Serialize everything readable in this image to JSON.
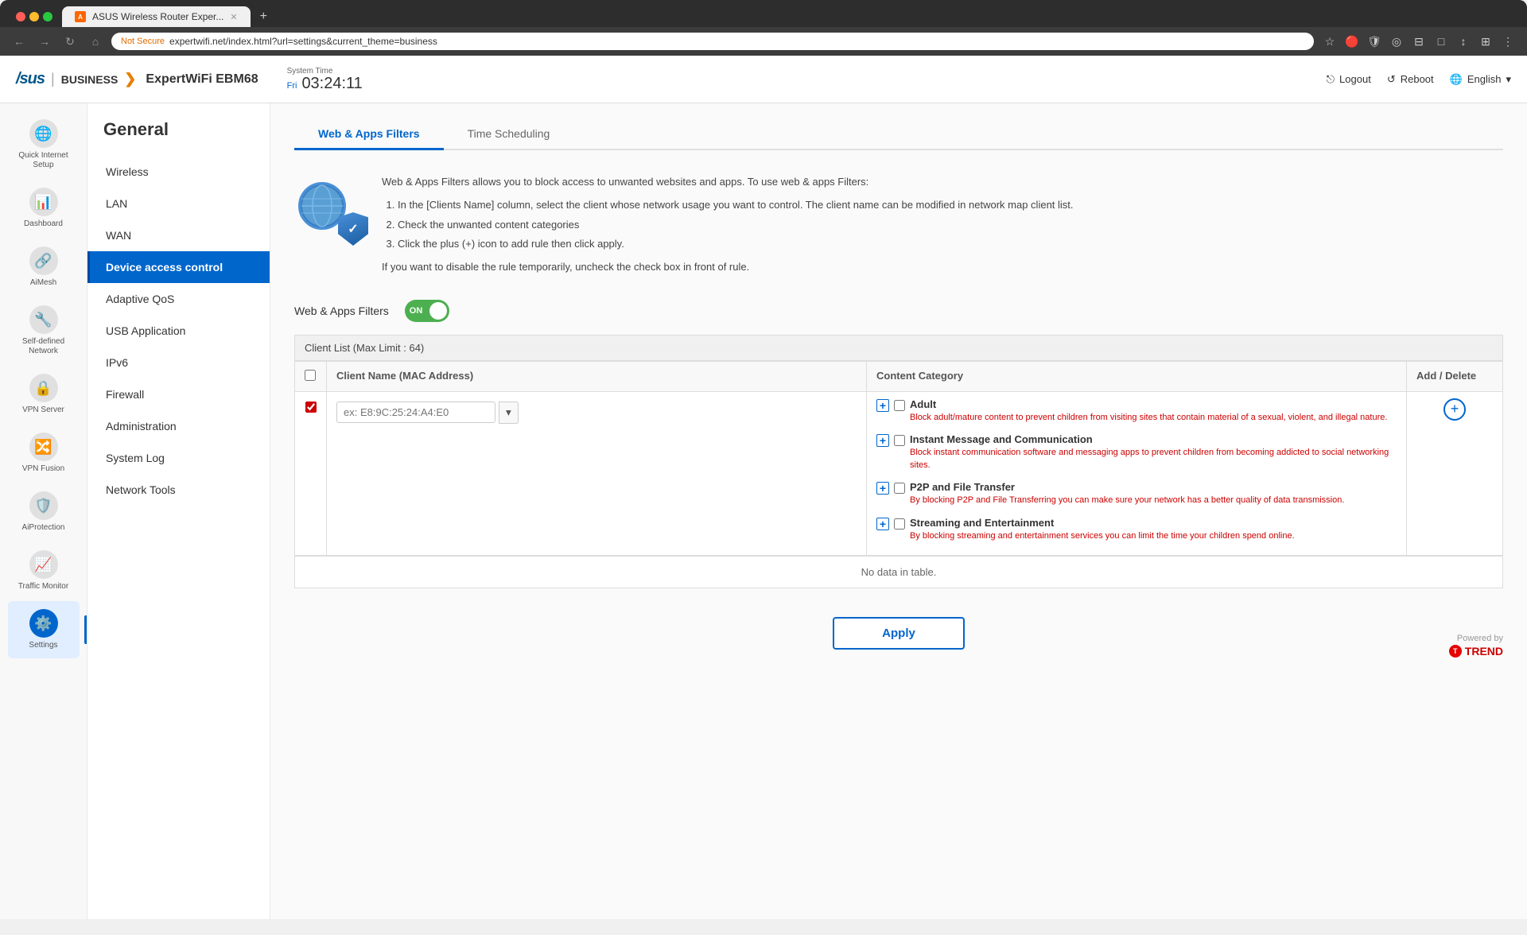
{
  "browser": {
    "tab_title": "ASUS Wireless Router Exper...",
    "url": "expertwifi.net/index.html?url=settings&current_theme=business",
    "not_secure_label": "Not Secure"
  },
  "header": {
    "asus_logo": "/sus",
    "business_label": "BUSINESS",
    "router_name": "ExpertWiFi EBM68",
    "time_label": "System Time",
    "time_day": "Fri",
    "time_value": "03:24:11",
    "logout_label": "Logout",
    "reboot_label": "Reboot",
    "language_label": "English"
  },
  "sidebar_icons": [
    {
      "id": "quick-internet-setup",
      "label": "Quick Internet\nSetup",
      "icon": "🌐"
    },
    {
      "id": "dashboard",
      "label": "Dashboard",
      "icon": "📊"
    },
    {
      "id": "aimesh",
      "label": "AiMesh",
      "icon": "🔗"
    },
    {
      "id": "self-defined-network",
      "label": "Self-defined\nNetwork",
      "icon": "🔧"
    },
    {
      "id": "vpn-server",
      "label": "VPN Server",
      "icon": "🔒"
    },
    {
      "id": "vpn-fusion",
      "label": "VPN Fusion",
      "icon": "🔀"
    },
    {
      "id": "aiprotection",
      "label": "AiProtection",
      "icon": "🛡️"
    },
    {
      "id": "traffic-monitor",
      "label": "Traffic Monitor",
      "icon": "📈"
    },
    {
      "id": "settings",
      "label": "Settings",
      "icon": "⚙️"
    }
  ],
  "left_nav": {
    "title": "General",
    "items": [
      {
        "id": "wireless",
        "label": "Wireless"
      },
      {
        "id": "lan",
        "label": "LAN"
      },
      {
        "id": "wan",
        "label": "WAN"
      },
      {
        "id": "device-access-control",
        "label": "Device access control",
        "active": true
      },
      {
        "id": "adaptive-qos",
        "label": "Adaptive QoS"
      },
      {
        "id": "usb-application",
        "label": "USB Application"
      },
      {
        "id": "ipv6",
        "label": "IPv6"
      },
      {
        "id": "firewall",
        "label": "Firewall"
      },
      {
        "id": "administration",
        "label": "Administration"
      },
      {
        "id": "system-log",
        "label": "System Log"
      },
      {
        "id": "network-tools",
        "label": "Network Tools"
      }
    ]
  },
  "tabs": [
    {
      "id": "web-apps-filters",
      "label": "Web & Apps Filters",
      "active": true
    },
    {
      "id": "time-scheduling",
      "label": "Time Scheduling"
    }
  ],
  "description": {
    "intro": "Web & Apps Filters allows you to block access to unwanted websites and apps. To use web & apps Filters:",
    "steps": [
      "In the [Clients Name] column, select the client whose network usage you want to control. The client name can be modified in network map client list.",
      "Check the unwanted content categories",
      "Click the plus (+) icon to add rule then click apply."
    ],
    "note": "If you want to disable the rule temporarily, uncheck the check box in front of rule."
  },
  "filter": {
    "label": "Web & Apps Filters",
    "toggle_state": "ON"
  },
  "client_list": {
    "header": "Client List (Max Limit : 64)",
    "columns": {
      "checkbox": "",
      "client_name": "Client Name (MAC Address)",
      "content_category": "Content Category",
      "add_delete": "Add / Delete"
    },
    "input_placeholder": "ex: E8:9C:25:24:A4:E0",
    "categories": [
      {
        "id": "adult",
        "label": "Adult",
        "desc": "Block adult/mature content to prevent children from visiting sites that contain material of a sexual, violent, and illegal nature."
      },
      {
        "id": "instant-message",
        "label": "Instant Message and Communication",
        "desc": "Block instant communication software and messaging apps to prevent children from becoming addicted to social networking sites."
      },
      {
        "id": "p2p-file-transfer",
        "label": "P2P and File Transfer",
        "desc": "By blocking P2P and File Transferring you can make sure your network has a better quality of data transmission."
      },
      {
        "id": "streaming",
        "label": "Streaming and Entertainment",
        "desc": "By blocking streaming and entertainment services you can limit the time your children spend online."
      }
    ],
    "no_data": "No data in table."
  },
  "apply_btn": "Apply",
  "powered_by": "Powered by",
  "trend_label": "TREND"
}
